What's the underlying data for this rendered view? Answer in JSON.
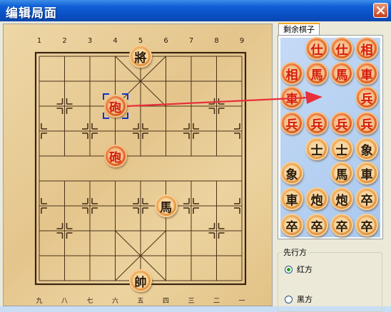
{
  "window": {
    "title": "编辑局面"
  },
  "board": {
    "top_numbers": [
      "1",
      "2",
      "3",
      "4",
      "5",
      "6",
      "7",
      "8",
      "9"
    ],
    "bottom_numbers": [
      "九",
      "八",
      "七",
      "六",
      "五",
      "四",
      "三",
      "二",
      "一"
    ],
    "pieces": [
      {
        "char": "將",
        "side": "black",
        "file": 4,
        "rank": 0
      },
      {
        "char": "砲",
        "side": "red",
        "file": 3,
        "rank": 2,
        "selected": true
      },
      {
        "char": "砲",
        "side": "red",
        "file": 3,
        "rank": 4
      },
      {
        "char": "馬",
        "side": "black",
        "file": 5,
        "rank": 6
      },
      {
        "char": "帥",
        "side": "black",
        "file": 4,
        "rank": 9
      }
    ]
  },
  "tray": {
    "tab_label": "剩余棋子",
    "pieces": [
      {
        "char": "仕",
        "side": "red",
        "col": 1,
        "row": 0
      },
      {
        "char": "仕",
        "side": "red",
        "col": 2,
        "row": 0
      },
      {
        "char": "相",
        "side": "red",
        "col": 3,
        "row": 0
      },
      {
        "char": "相",
        "side": "red",
        "col": 0,
        "row": 1
      },
      {
        "char": "馬",
        "side": "red",
        "col": 1,
        "row": 1
      },
      {
        "char": "馬",
        "side": "red",
        "col": 2,
        "row": 1
      },
      {
        "char": "車",
        "side": "red",
        "col": 3,
        "row": 1
      },
      {
        "char": "車",
        "side": "red",
        "col": 0,
        "row": 2
      },
      {
        "char": "兵",
        "side": "red",
        "col": 3,
        "row": 2
      },
      {
        "char": "兵",
        "side": "red",
        "col": 0,
        "row": 3
      },
      {
        "char": "兵",
        "side": "red",
        "col": 1,
        "row": 3
      },
      {
        "char": "兵",
        "side": "red",
        "col": 2,
        "row": 3
      },
      {
        "char": "兵",
        "side": "red",
        "col": 3,
        "row": 3
      },
      {
        "char": "士",
        "side": "black",
        "col": 1,
        "row": 4
      },
      {
        "char": "士",
        "side": "black",
        "col": 2,
        "row": 4
      },
      {
        "char": "象",
        "side": "black",
        "col": 3,
        "row": 4
      },
      {
        "char": "象",
        "side": "black",
        "col": 0,
        "row": 5
      },
      {
        "char": "馬",
        "side": "black",
        "col": 2,
        "row": 5
      },
      {
        "char": "車",
        "side": "black",
        "col": 3,
        "row": 5
      },
      {
        "char": "車",
        "side": "black",
        "col": 0,
        "row": 6
      },
      {
        "char": "炮",
        "side": "black",
        "col": 1,
        "row": 6
      },
      {
        "char": "炮",
        "side": "black",
        "col": 2,
        "row": 6
      },
      {
        "char": "卒",
        "side": "black",
        "col": 3,
        "row": 6
      },
      {
        "char": "卒",
        "side": "black",
        "col": 0,
        "row": 7
      },
      {
        "char": "卒",
        "side": "black",
        "col": 1,
        "row": 7
      },
      {
        "char": "卒",
        "side": "black",
        "col": 2,
        "row": 7
      },
      {
        "char": "卒",
        "side": "black",
        "col": 3,
        "row": 7
      }
    ]
  },
  "first_move": {
    "legend": "先行方",
    "options": [
      {
        "label": "红方",
        "checked": true
      },
      {
        "label": "黑方",
        "checked": false
      }
    ]
  },
  "colors": {
    "title_bar": "#0a4fc4",
    "arrow": "#e8303a",
    "selection": "#1030d0"
  }
}
